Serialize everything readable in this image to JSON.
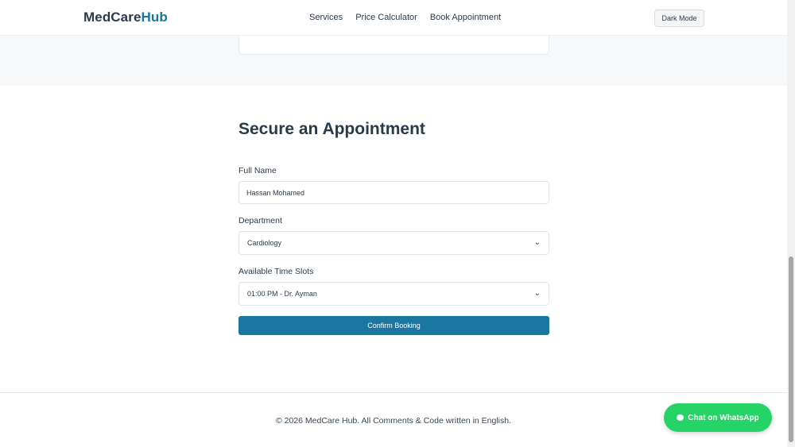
{
  "header": {
    "brand_part1": "MedCare",
    "brand_part2": "Hub",
    "nav": [
      "Services",
      "Price Calculator",
      "Book Appointment"
    ],
    "dark_mode_label": "Dark Mode"
  },
  "booking": {
    "title": "Secure an Appointment",
    "full_name_label": "Full Name",
    "full_name_value": "Hassan Mohamed",
    "department_label": "Department",
    "department_value": "Cardiology",
    "time_slots_label": "Available Time Slots",
    "time_slot_value": "01:00 PM - Dr. Ayman",
    "confirm_label": "Confirm Booking"
  },
  "footer": {
    "text": "© 2026 MedCare Hub. All Comments & Code written in English."
  },
  "whatsapp": {
    "label": "Chat on WhatsApp"
  },
  "colors": {
    "accent": "#157a99",
    "primary_button": "#1b76a0",
    "whatsapp_green": "#25d366"
  }
}
